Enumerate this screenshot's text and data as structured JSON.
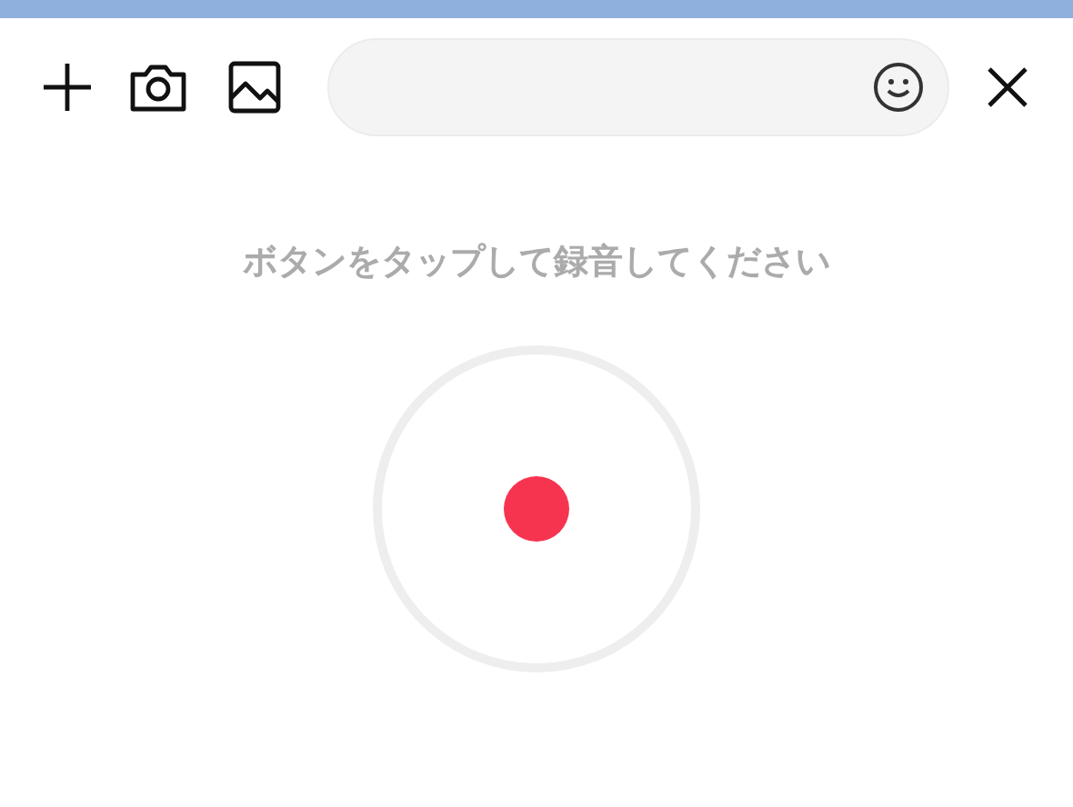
{
  "prompt": "ボタンをタップして録音してください"
}
